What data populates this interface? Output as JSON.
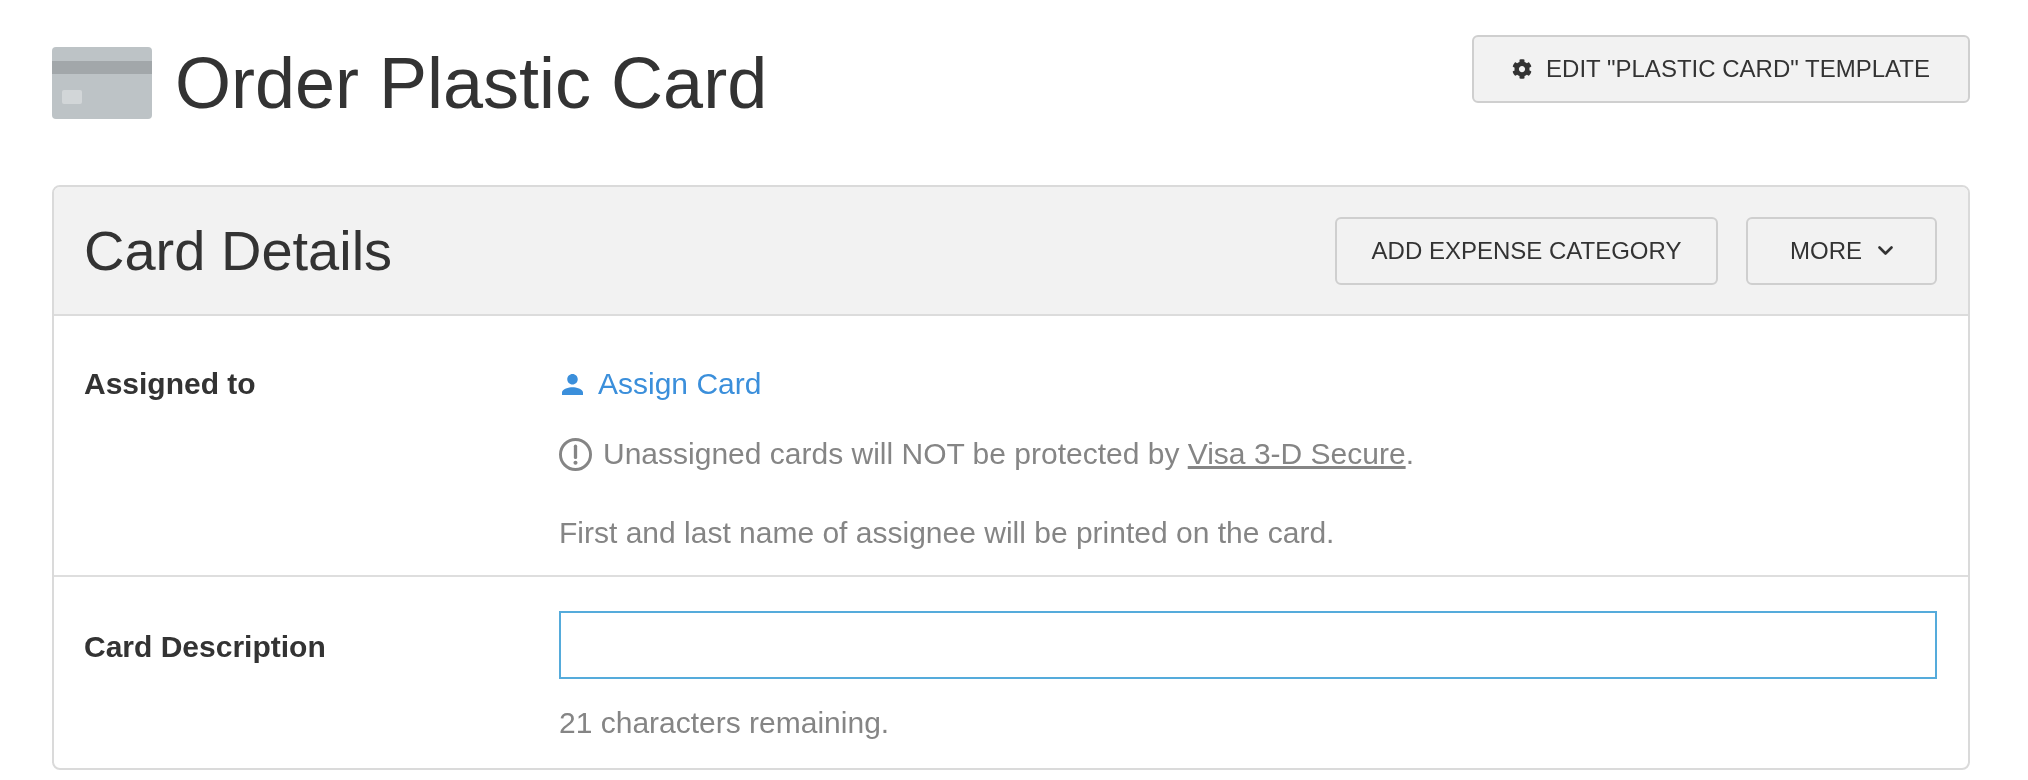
{
  "page": {
    "title": "Order Plastic Card",
    "template_button": "EDIT \"PLASTIC CARD\" TEMPLATE"
  },
  "card": {
    "title": "Card Details",
    "buttons": [
      {
        "label": "ADD EXPENSE CATEGORY",
        "kind": "plain"
      },
      {
        "label": "MORE",
        "kind": "dropdown"
      }
    ],
    "rows": [
      {
        "kind": "assign",
        "label": "Assigned to",
        "link": "Assign Card",
        "warning": {
          "text": "Unassigned cards will NOT be protected by ",
          "link": "Visa 3-D Secure",
          "after": "."
        },
        "note": "First and last name of assignee will be printed on the card."
      },
      {
        "kind": "input",
        "label": "Card Description",
        "focused": true,
        "helper": "21 characters remaining."
      }
    ]
  }
}
